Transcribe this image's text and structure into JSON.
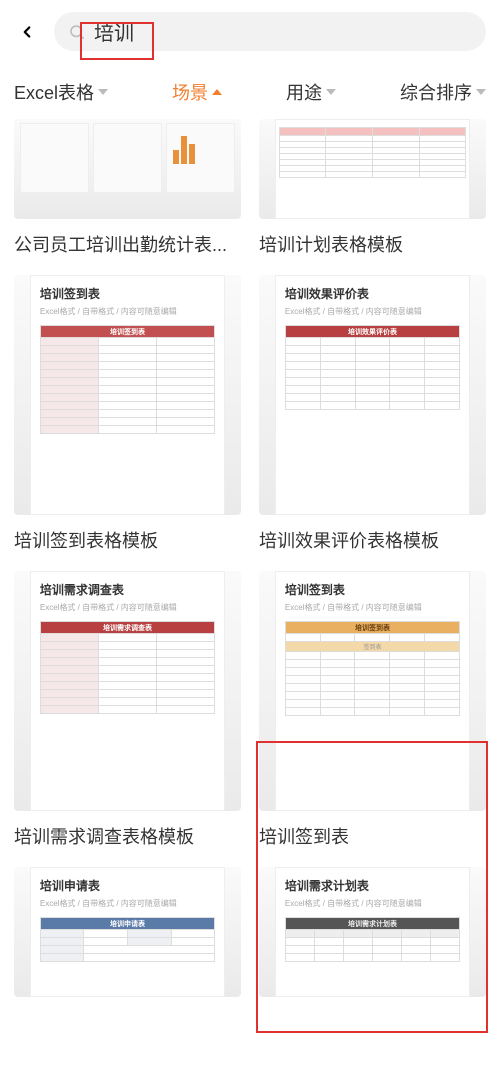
{
  "search": {
    "placeholder": "",
    "value": "培训"
  },
  "filters": {
    "format": "Excel表格",
    "scene": "场景",
    "purpose": "用途",
    "sort": "综合排序"
  },
  "cards": [
    {
      "title": "公司员工培训出勤统计表...",
      "docTitle": "",
      "docSub": ""
    },
    {
      "title": "培训计划表格模板",
      "docTitle": "",
      "docSub": ""
    },
    {
      "title": "培训签到表格模板",
      "docTitle": "培训签到表",
      "docSub": "Excel格式 / 自带格式 / 内容可随意编辑"
    },
    {
      "title": "培训效果评价表格模板",
      "docTitle": "培训效果评价表",
      "docSub": "Excel格式 / 自带格式 / 内容可随意编辑"
    },
    {
      "title": "培训需求调查表格模板",
      "docTitle": "培训需求调查表",
      "docSub": "Excel格式 / 自带格式 / 内容可随意编辑"
    },
    {
      "title": "培训签到表",
      "docTitle": "培训签到表",
      "docSub": "Excel格式 / 自带格式 / 内容可随意编辑"
    },
    {
      "title": "",
      "docTitle": "培训申请表",
      "docSub": "Excel格式 / 自带格式 / 内容可随意编辑"
    },
    {
      "title": "",
      "docTitle": "培训需求计划表",
      "docSub": "Excel格式 / 自带格式 / 内容可随意编辑"
    }
  ],
  "doc_headers": {
    "signin": "培训签到表",
    "effect": "培训效果评价表",
    "demand": "培训需求调查表",
    "demand2": "培训需求计划表",
    "apply": "培训申请表",
    "signin2": "培训签到表",
    "signin_col": "签到表"
  }
}
